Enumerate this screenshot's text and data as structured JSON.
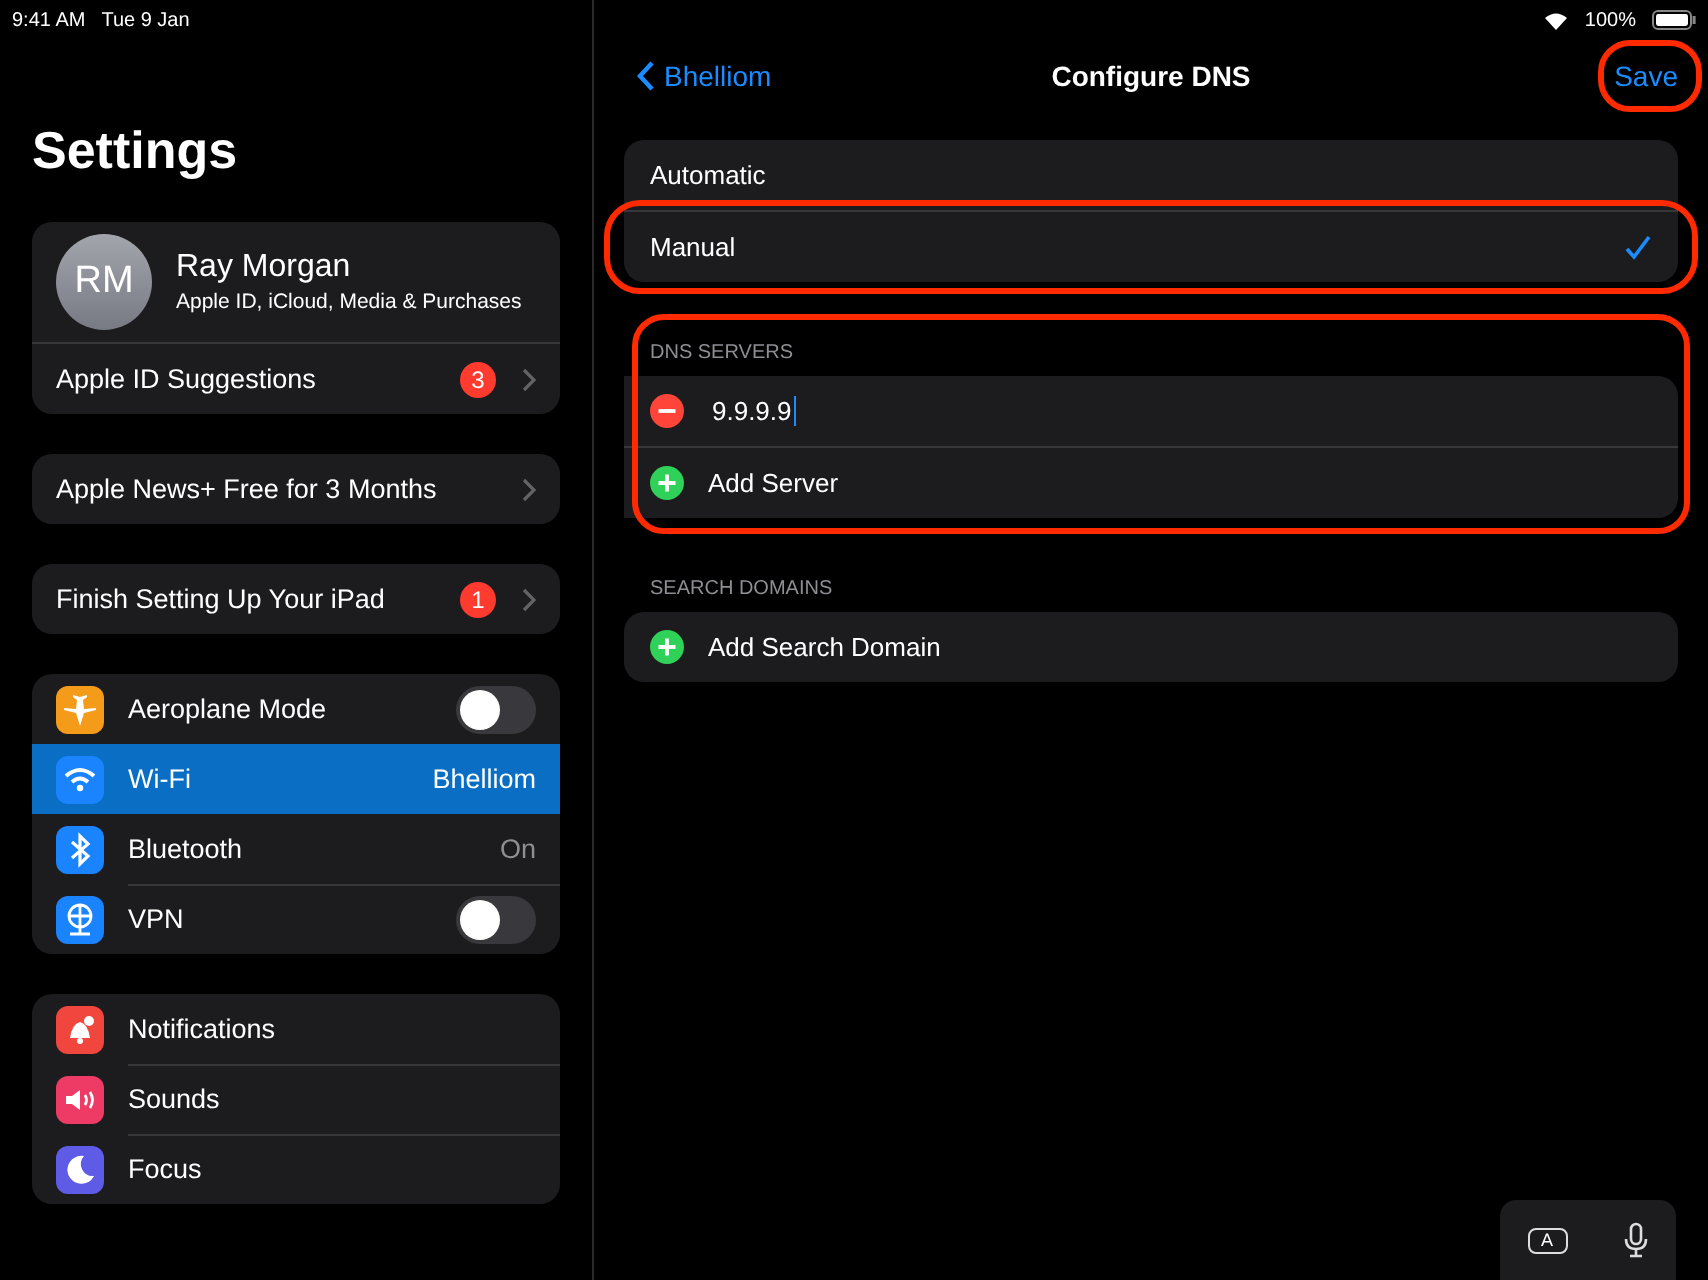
{
  "status_bar": {
    "time": "9:41 AM",
    "date": "Tue 9 Jan",
    "battery": "100%"
  },
  "sidebar": {
    "title": "Settings",
    "profile_card": {
      "initials": "RM",
      "name": "Ray Morgan",
      "subtitle": "Apple ID, iCloud, Media & Purchases",
      "items": [
        {
          "kind": "link",
          "label": "Apple ID Suggestions",
          "badge": "3",
          "selected": false
        }
      ]
    },
    "groups": [
      {
        "items": [
          {
            "kind": "link",
            "label": "Apple News+ Free for 3 Months",
            "selected": false
          }
        ]
      },
      {
        "items": [
          {
            "kind": "link",
            "label": "Finish Setting Up Your iPad",
            "badge": "1",
            "selected": false
          }
        ]
      },
      {
        "items": [
          {
            "kind": "toggle",
            "label": "Aeroplane Mode",
            "on": false,
            "selected": false
          },
          {
            "kind": "value",
            "label": "Wi-Fi",
            "value": "Bhelliom",
            "selected": true
          },
          {
            "kind": "value",
            "label": "Bluetooth",
            "value": "On",
            "selected": false
          },
          {
            "kind": "toggle",
            "label": "VPN",
            "on": false,
            "selected": false
          }
        ]
      },
      {
        "items": [
          {
            "kind": "plain",
            "label": "Notifications",
            "selected": false
          },
          {
            "kind": "plain",
            "label": "Sounds",
            "selected": false
          },
          {
            "kind": "plain",
            "label": "Focus",
            "selected": false
          }
        ]
      }
    ]
  },
  "detail": {
    "nav": {
      "back": "Bhelliom",
      "title": "Configure DNS",
      "action": {
        "label": "Save",
        "highlighted": true
      }
    },
    "modes": [
      {
        "label": "Automatic",
        "selected": false
      },
      {
        "label": "Manual",
        "selected": true,
        "highlighted": true
      }
    ],
    "sections": [
      {
        "header": "DNS SERVERS",
        "highlighted": true,
        "rows": [
          {
            "kind": "entry",
            "value": "9.9.9.9"
          },
          {
            "kind": "add",
            "label": "Add Server"
          }
        ]
      },
      {
        "header": "SEARCH DOMAINS",
        "highlighted": false,
        "rows": [
          {
            "kind": "add",
            "label": "Add Search Domain"
          }
        ]
      }
    ]
  },
  "keyboard_bar": {
    "key": "A"
  }
}
